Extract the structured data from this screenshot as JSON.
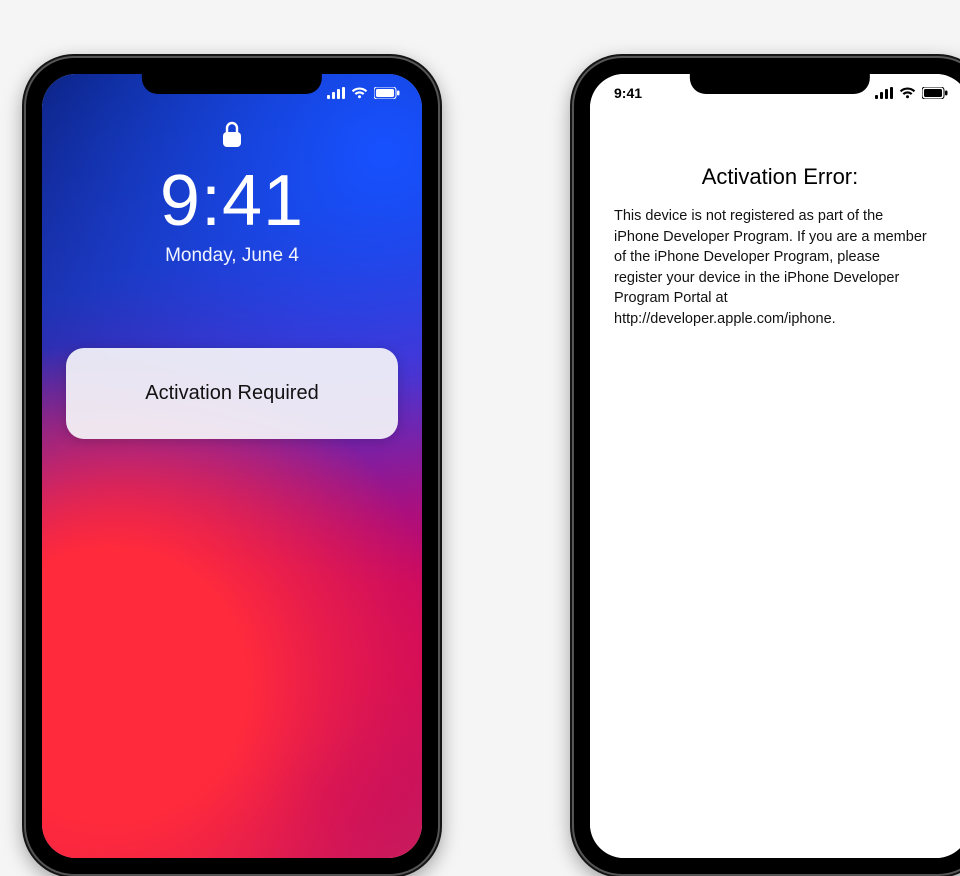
{
  "colors": {
    "card_bg": "rgba(245,245,248,.92)",
    "text_dark": "#111111",
    "text_light": "#ffffff"
  },
  "left_phone": {
    "statusbar": {
      "time": ""
    },
    "lock": {
      "time": "9:41",
      "date": "Monday, June 4"
    },
    "card": {
      "label": "Activation Required"
    }
  },
  "right_phone": {
    "statusbar": {
      "time": "9:41"
    },
    "error": {
      "title": "Activation Error:",
      "body": "This device is not registered as part of the iPhone Developer Program. If you are a member of the iPhone Developer Program, please register your device in the iPhone Developer Program Portal at http://developer.apple.com/iphone."
    }
  }
}
